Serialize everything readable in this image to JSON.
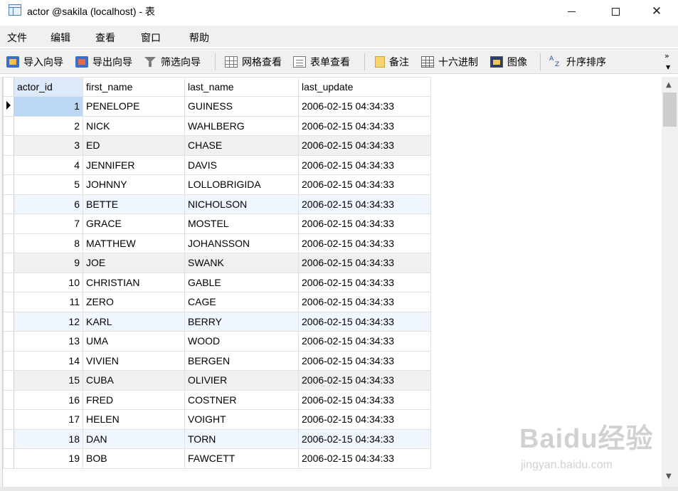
{
  "window": {
    "title": "actor @sakila (localhost) - 表",
    "close_glyph": "✕"
  },
  "menu": [
    "文件",
    "编辑",
    "查看",
    "窗口",
    "帮助"
  ],
  "toolbar": {
    "buttons": [
      {
        "label": "导入向导",
        "icon": "import-wizard-icon"
      },
      {
        "label": "导出向导",
        "icon": "export-wizard-icon"
      },
      {
        "label": "筛选向导",
        "icon": "filter-icon"
      },
      {
        "label": "网格查看",
        "icon": "grid-view-icon"
      },
      {
        "label": "表单查看",
        "icon": "form-view-icon"
      },
      {
        "label": "备注",
        "icon": "memo-icon"
      },
      {
        "label": "十六进制",
        "icon": "hex-icon"
      },
      {
        "label": "图像",
        "icon": "image-icon"
      },
      {
        "label": "升序排序",
        "icon": "sort-ascending-icon"
      }
    ],
    "more_glyph": "»",
    "more_down_glyph": "▼"
  },
  "table": {
    "columns": [
      "actor_id",
      "first_name",
      "last_name",
      "last_update"
    ],
    "rows": [
      [
        "1",
        "PENELOPE",
        "GUINESS",
        "2006-02-15 04:34:33"
      ],
      [
        "2",
        "NICK",
        "WAHLBERG",
        "2006-02-15 04:34:33"
      ],
      [
        "3",
        "ED",
        "CHASE",
        "2006-02-15 04:34:33"
      ],
      [
        "4",
        "JENNIFER",
        "DAVIS",
        "2006-02-15 04:34:33"
      ],
      [
        "5",
        "JOHNNY",
        "LOLLOBRIGIDA",
        "2006-02-15 04:34:33"
      ],
      [
        "6",
        "BETTE",
        "NICHOLSON",
        "2006-02-15 04:34:33"
      ],
      [
        "7",
        "GRACE",
        "MOSTEL",
        "2006-02-15 04:34:33"
      ],
      [
        "8",
        "MATTHEW",
        "JOHANSSON",
        "2006-02-15 04:34:33"
      ],
      [
        "9",
        "JOE",
        "SWANK",
        "2006-02-15 04:34:33"
      ],
      [
        "10",
        "CHRISTIAN",
        "GABLE",
        "2006-02-15 04:34:33"
      ],
      [
        "11",
        "ZERO",
        "CAGE",
        "2006-02-15 04:34:33"
      ],
      [
        "12",
        "KARL",
        "BERRY",
        "2006-02-15 04:34:33"
      ],
      [
        "13",
        "UMA",
        "WOOD",
        "2006-02-15 04:34:33"
      ],
      [
        "14",
        "VIVIEN",
        "BERGEN",
        "2006-02-15 04:34:33"
      ],
      [
        "15",
        "CUBA",
        "OLIVIER",
        "2006-02-15 04:34:33"
      ],
      [
        "16",
        "FRED",
        "COSTNER",
        "2006-02-15 04:34:33"
      ],
      [
        "17",
        "HELEN",
        "VOIGHT",
        "2006-02-15 04:34:33"
      ],
      [
        "18",
        "DAN",
        "TORN",
        "2006-02-15 04:34:33"
      ],
      [
        "19",
        "BOB",
        "FAWCETT",
        "2006-02-15 04:34:33"
      ]
    ],
    "selected_row": 0
  },
  "scrollbar": {
    "up_glyph": "▲",
    "down_glyph": "▼"
  },
  "watermark": {
    "brand": "Baidu经验",
    "url": "jingyan.baidu.com"
  },
  "colors": {
    "header_selected": "#dbe9f9",
    "cell_selected": "#bcd7f5",
    "row_alt_gray": "#f0f0f0",
    "row_alt_blue": "#f0f6fe"
  }
}
